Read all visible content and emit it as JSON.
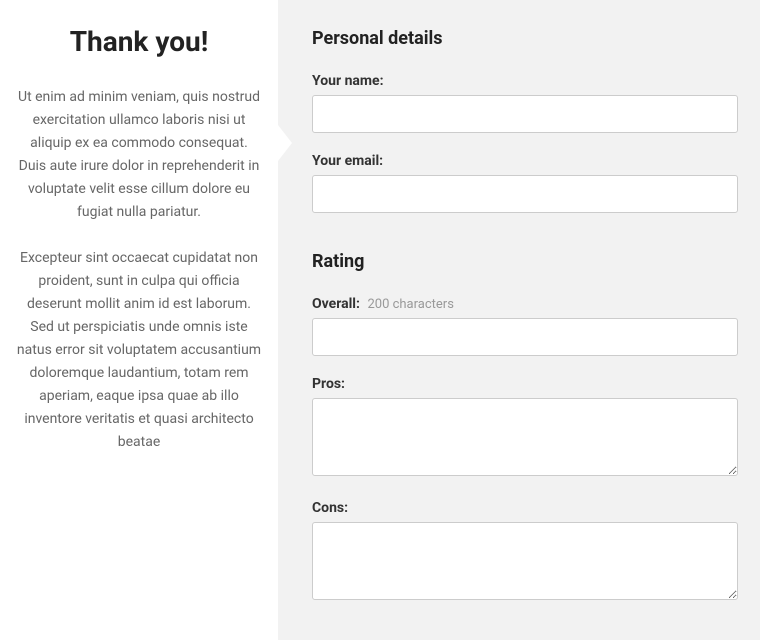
{
  "left": {
    "title": "Thank you!",
    "para1": "Ut enim ad minim veniam, quis nostrud exercitation ullamco laboris nisi ut aliquip ex ea commodo consequat. Duis aute irure dolor in reprehenderit in voluptate velit esse cillum dolore eu fugiat nulla pariatur.",
    "para2": "Excepteur sint occaecat cupidatat non proident, sunt in culpa qui officia deserunt mollit anim id est laborum. Sed ut perspiciatis unde omnis iste natus error sit voluptatem accusantium doloremque laudantium, totam rem aperiam, eaque ipsa quae ab illo inventore veritatis et quasi architecto beatae"
  },
  "form": {
    "personal": {
      "heading": "Personal details",
      "name_label": "Your name:",
      "name_value": "",
      "email_label": "Your email:",
      "email_value": ""
    },
    "rating": {
      "heading": "Rating",
      "overall_label": "Overall:",
      "overall_hint": "200 characters",
      "overall_value": "",
      "pros_label": "Pros:",
      "pros_value": "",
      "cons_label": "Cons:",
      "cons_value": ""
    }
  }
}
